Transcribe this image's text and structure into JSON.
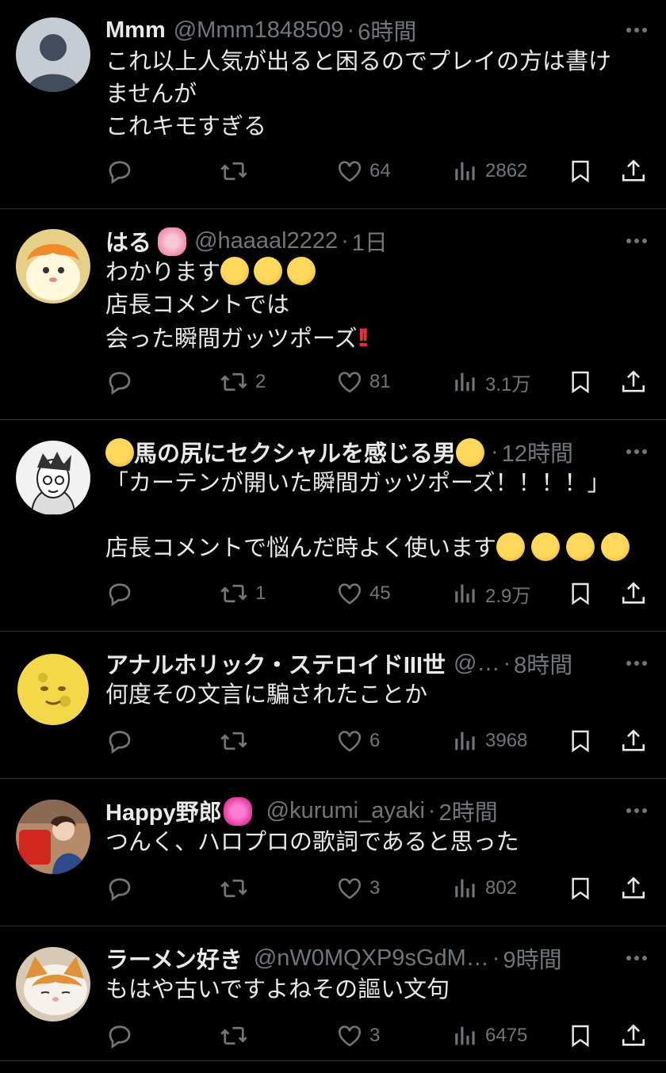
{
  "tweets": [
    {
      "name": "Mmm",
      "handle": "@Mmm1848509",
      "time": "6時間",
      "lines": [
        "これ以上人気が出ると困るのでプレイの方は書け",
        "ませんが",
        "これキモすぎる"
      ],
      "replies": "",
      "retweets": "",
      "likes": "64",
      "views": "2862",
      "avatar": "default-avatar"
    },
    {
      "name": "はる",
      "handle": "@haaaal2222",
      "time": "1日",
      "lines": [
        "わかります",
        "店長コメントでは",
        "会った瞬間ガッツポーズ"
      ],
      "replies": "",
      "retweets": "2",
      "likes": "81",
      "views": "3.1万",
      "avatar": "hamster-avatar"
    },
    {
      "name": "馬の尻にセクシャルを感じる男",
      "handle": "",
      "time": "12時間",
      "lines": [
        "「カーテンが開いた瞬間ガッツポーズ！！！！」",
        "",
        "店長コメントで悩んだ時よく使います"
      ],
      "replies": "",
      "retweets": "1",
      "likes": "45",
      "views": "2.9万",
      "avatar": "manga-avatar"
    },
    {
      "name": "アナルホリック・ステロイドIII世",
      "handle": "@…",
      "time": "8時間",
      "lines": [
        "何度その文言に騙されたことか"
      ],
      "replies": "",
      "retweets": "",
      "likes": "6",
      "views": "3968",
      "avatar": "moon-avatar"
    },
    {
      "name": "Happy野郎",
      "handle": "@kurumi_ayaki",
      "time": "2時間",
      "lines": [
        "つんく、ハロプロの歌詞であると思った"
      ],
      "replies": "",
      "retweets": "",
      "likes": "3",
      "views": "802",
      "avatar": "phone-photo-avatar"
    },
    {
      "name": "ラーメン好き",
      "handle": "@nW0MQXP9sGdM…",
      "time": "9時間",
      "lines": [
        "もはや古いですよねその謳い文句"
      ],
      "replies": "",
      "retweets": "",
      "likes": "3",
      "views": "6475",
      "avatar": "cat-avatar"
    }
  ],
  "separator": "·",
  "colors": {
    "background": "#000000",
    "text": "#e7e9ea",
    "muted": "#71767b",
    "divider": "#2f3336"
  },
  "icons": [
    "more-icon",
    "reply-icon",
    "retweet-icon",
    "like-icon",
    "views-icon",
    "bookmark-icon",
    "share-icon"
  ]
}
